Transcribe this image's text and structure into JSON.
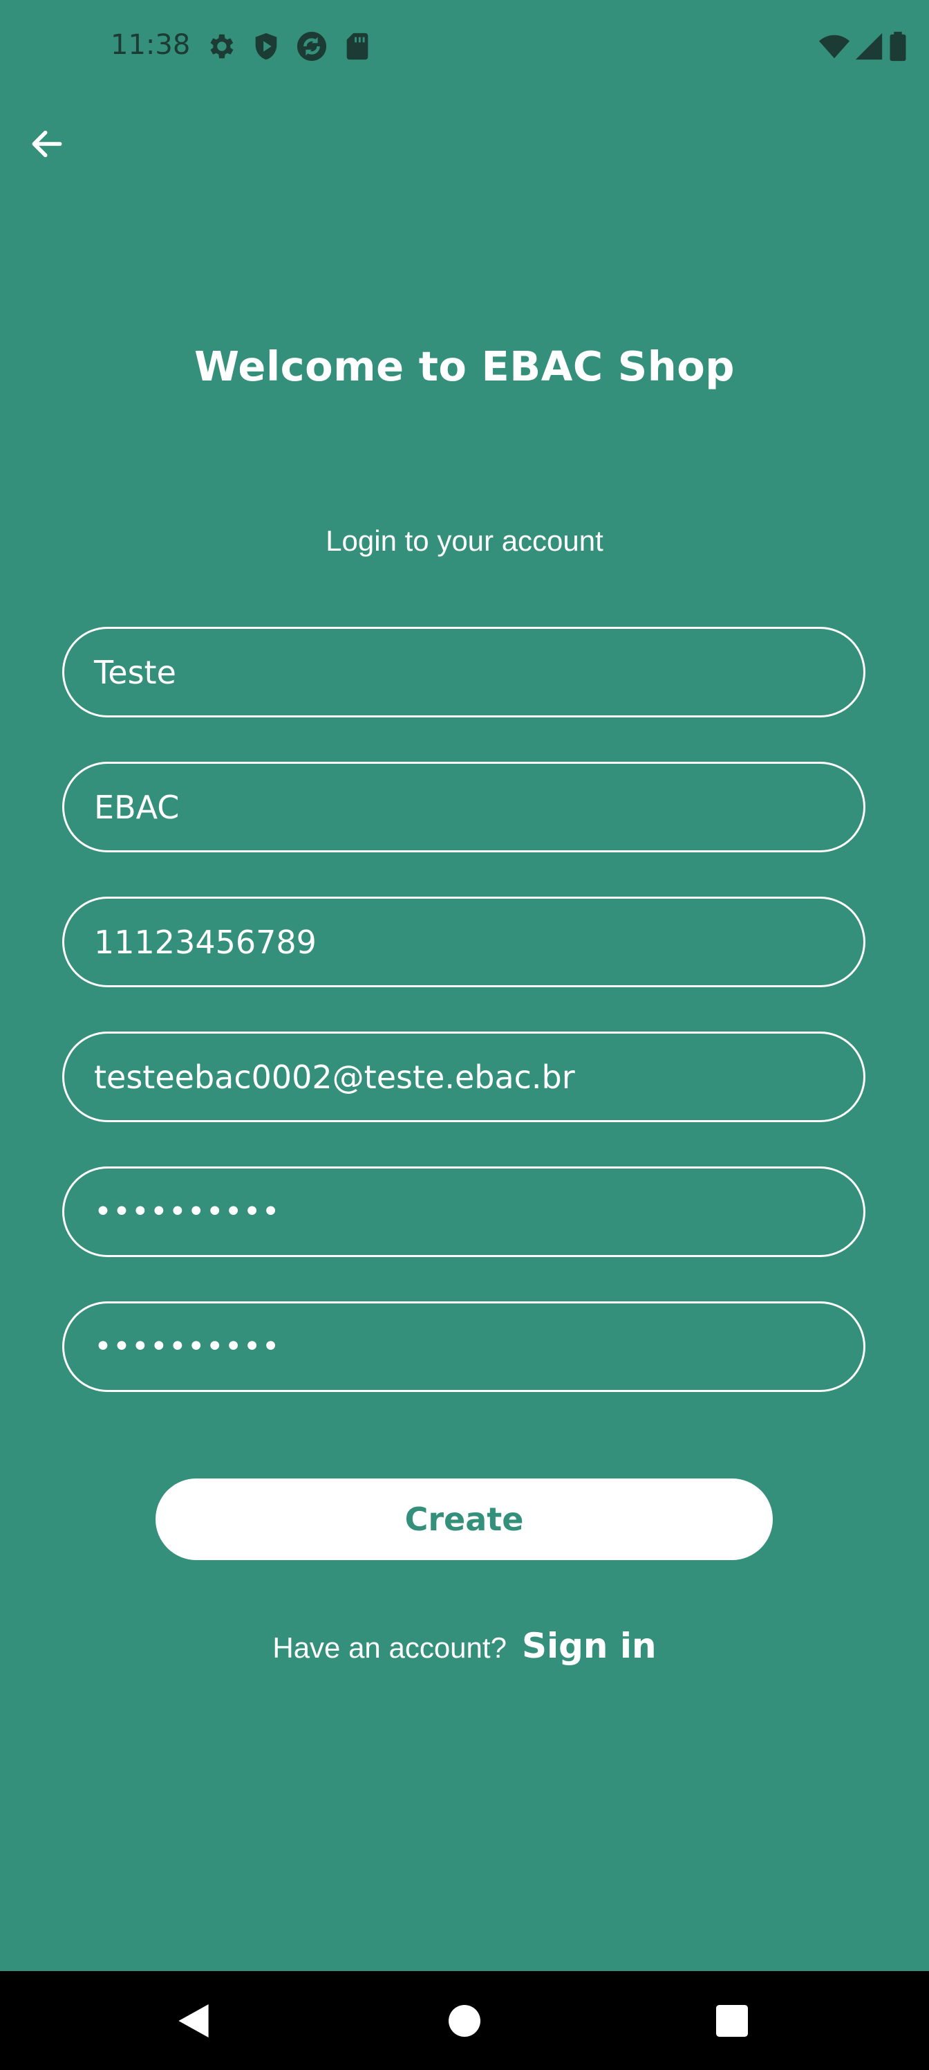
{
  "status_bar": {
    "time": "11:38",
    "icons_left": [
      "settings-icon",
      "shield-icon",
      "sync-icon",
      "sd-card-icon"
    ],
    "icons_right": [
      "wifi-icon",
      "signal-icon",
      "battery-icon"
    ]
  },
  "header": {
    "back_icon": "arrow-left-icon"
  },
  "main": {
    "title": "Welcome to EBAC Shop",
    "subtitle": "Login to your account",
    "fields": {
      "first_name": "Teste",
      "last_name": "EBAC",
      "phone": "11123456789",
      "email": "testeebac0002@teste.ebac.br",
      "password": "••••••••••",
      "confirm_password": "••••••••••"
    },
    "create_label": "Create",
    "signin_prompt": "Have an account?",
    "signin_label": "Sign in"
  },
  "nav_bar": {
    "icons": [
      "back-triangle-icon",
      "home-circle-icon",
      "recents-square-icon"
    ]
  },
  "colors": {
    "background": "#35907b",
    "text": "#ffffff",
    "button_text": "#35907b",
    "nav_bar": "#000000"
  }
}
